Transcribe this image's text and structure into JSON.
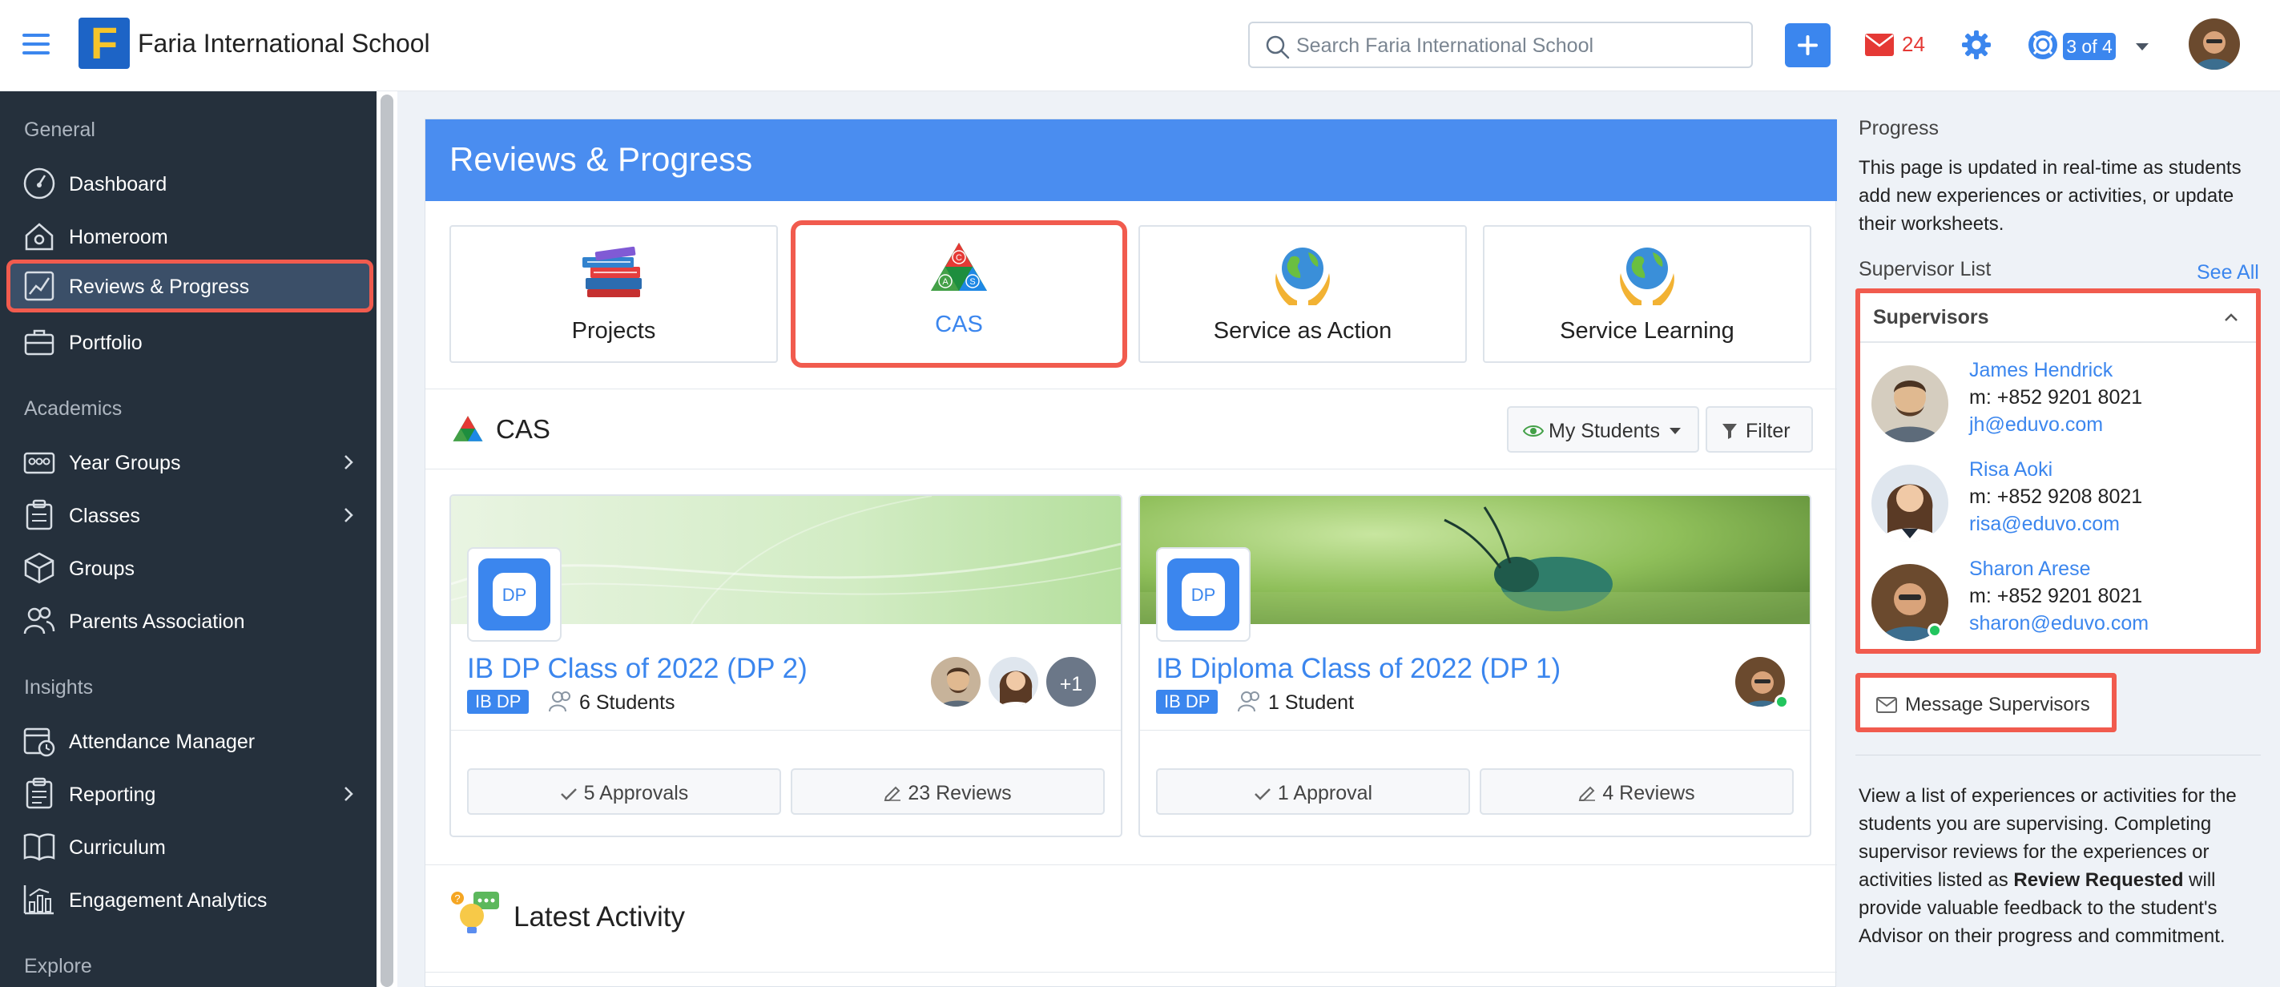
{
  "header": {
    "logo_letter": "F",
    "school_name": "Faria International School",
    "search_placeholder": "Search Faria International School",
    "mail_count": "24",
    "account_pill": "3 of 4"
  },
  "sidebar": {
    "sections": [
      {
        "title": "General",
        "items": [
          {
            "label": "Dashboard",
            "icon": "dashboard-icon"
          },
          {
            "label": "Homeroom",
            "icon": "homeroom-icon"
          },
          {
            "label": "Reviews & Progress",
            "icon": "chart-line-icon",
            "active": true
          },
          {
            "label": "Portfolio",
            "icon": "briefcase-icon"
          }
        ]
      },
      {
        "title": "Academics",
        "items": [
          {
            "label": "Year Groups",
            "icon": "year-groups-icon",
            "chevron": true
          },
          {
            "label": "Classes",
            "icon": "classes-icon",
            "chevron": true
          },
          {
            "label": "Groups",
            "icon": "cube-icon"
          },
          {
            "label": "Parents Association",
            "icon": "users-icon"
          }
        ]
      },
      {
        "title": "Insights",
        "items": [
          {
            "label": "Attendance Manager",
            "icon": "calendar-clock-icon"
          },
          {
            "label": "Reporting",
            "icon": "report-icon",
            "chevron": true
          },
          {
            "label": "Curriculum",
            "icon": "book-icon"
          },
          {
            "label": "Engagement Analytics",
            "icon": "analytics-icon"
          }
        ]
      },
      {
        "title": "Explore",
        "items": []
      }
    ]
  },
  "main": {
    "title": "Reviews & Progress",
    "tiles": [
      {
        "label": "Projects",
        "icon": "books-icon"
      },
      {
        "label": "CAS",
        "icon": "cas-triangle-icon",
        "selected": true
      },
      {
        "label": "Service as Action",
        "icon": "globe-hands-icon"
      },
      {
        "label": "Service Learning",
        "icon": "globe-hands-icon"
      }
    ],
    "section_title": "CAS",
    "my_students_label": "My Students",
    "filter_label": "Filter",
    "cards": [
      {
        "title": "IB DP Class of 2022 (DP 2)",
        "badge": "IB DP",
        "students": "6 Students",
        "extra_count": "+1",
        "approvals": "5 Approvals",
        "reviews": "23 Reviews",
        "dp_label": "DP"
      },
      {
        "title": "IB Diploma Class of 2022 (DP 1)",
        "badge": "IB DP",
        "students": "1 Student",
        "approvals": "1 Approval",
        "reviews": "4 Reviews",
        "dp_label": "DP"
      }
    ],
    "latest_activity": "Latest Activity"
  },
  "right": {
    "progress_title": "Progress",
    "progress_text": "This page is updated in real-time as students add new experiences or activities, or update their worksheets.",
    "supervisor_list": "Supervisor List",
    "see_all": "See All",
    "supervisors_header": "Supervisors",
    "supervisors": [
      {
        "name": "James Hendrick",
        "phone": "m: +852 9201 8021",
        "email": "jh@eduvo.com"
      },
      {
        "name": "Risa Aoki",
        "phone": "m: +852 9208 8021",
        "email": "risa@eduvo.com"
      },
      {
        "name": "Sharon Arese",
        "phone": "m: +852 9201 8021",
        "email": "sharon@eduvo.com"
      }
    ],
    "message_button": "Message Supervisors",
    "info_part1": "View a list of experiences or activities for the students you are supervising. Completing supervisor reviews for the experiences or activities listed as ",
    "info_bold": "Review Requested",
    "info_part2": " will provide valuable feedback to the student's Advisor on their progress and commitment."
  },
  "colors": {
    "accent": "#3b86ee",
    "sidebar_bg": "#25303c",
    "highlight": "#f15b4e",
    "header_blue": "#4a8df0"
  }
}
